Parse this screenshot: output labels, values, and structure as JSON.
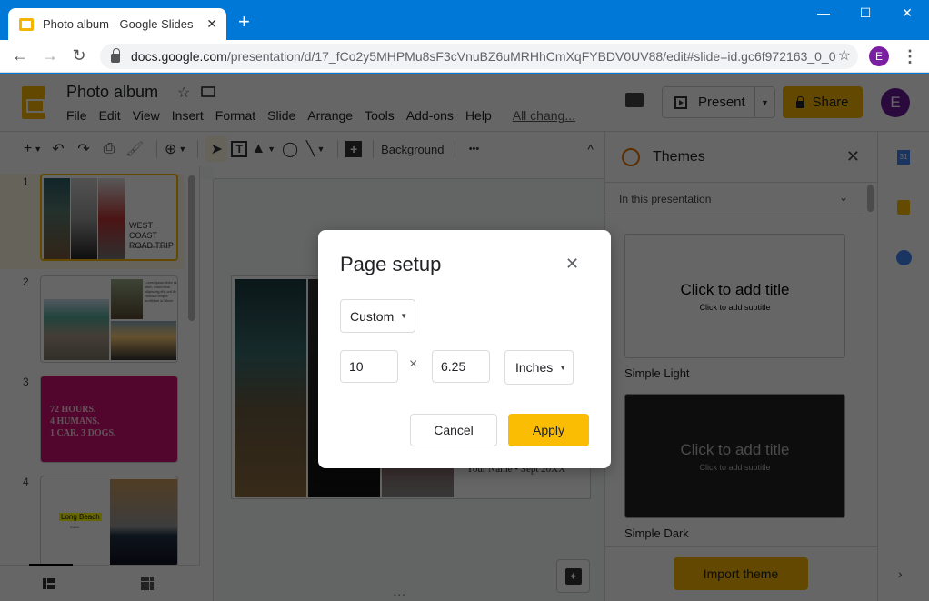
{
  "browser": {
    "tab_title": "Photo album - Google Slides",
    "tab_close": "✕",
    "new_tab": "+",
    "window_controls": {
      "minimize": "—",
      "maximize": "☐",
      "close": "✕"
    },
    "nav": {
      "back": "←",
      "forward": "→",
      "reload": "↻"
    },
    "url_host": "docs.google.com",
    "url_path": "/presentation/d/17_fCo2y5MHPMu8sF3cVnuBZ6uMRHhCmXqFYBDV0UV88/edit#slide=id.gc6f972163_0_0",
    "bookmark_star": "☆",
    "profile_initial": "E",
    "menu_kebab": "⋮"
  },
  "app": {
    "doc_title": "Photo album",
    "title_star": "☆",
    "menu": [
      "File",
      "Edit",
      "View",
      "Insert",
      "Format",
      "Slide",
      "Arrange",
      "Tools",
      "Add-ons",
      "Help"
    ],
    "save_status": "All chang...",
    "present_label": "Present",
    "present_caret": "▼",
    "share_label": "Share",
    "account_initial": "E",
    "accent_color": "#f4b400"
  },
  "toolbar": {
    "new_slide": "+",
    "caret": "▼",
    "undo": "↶",
    "redo": "↷",
    "print": "⎙",
    "paint_format": "🖌",
    "zoom": "⊕",
    "select": "➤",
    "textbox": "T",
    "image": "▲",
    "shape": "◯",
    "line": "╲",
    "comment": "+",
    "background_label": "Background",
    "more": "•••",
    "collapse": "^"
  },
  "filmstrip": {
    "slides": [
      {
        "number": "1",
        "title": "WEST COAST ROAD TRIP",
        "subtitle": "Your Name • Sept 20XX"
      },
      {
        "number": "2",
        "body": "Lorem ipsum dolor sit amet, consectetur adipiscing elit, sed do eiusmod tempor incididunt ut labore"
      },
      {
        "number": "3",
        "lines": [
          "72 HOURS.",
          "4 HUMANS.",
          "1 CAR. 3 DOGS."
        ]
      },
      {
        "number": "4",
        "title": "Long Beach",
        "subtitle": "Caption"
      }
    ]
  },
  "canvas": {
    "slide_subtext": "Your Name • Sept 20XX"
  },
  "themes": {
    "title": "Themes",
    "close": "✕",
    "filter_label": "In this presentation",
    "filter_chevron": "⌄",
    "cards": [
      {
        "name": "Simple Light",
        "title": "Click to add title",
        "subtitle": "Click to add subtitle"
      },
      {
        "name": "Simple Dark",
        "title": "Click to add title",
        "subtitle": "Click to add subtitle"
      }
    ],
    "import_label": "Import theme"
  },
  "rail": {
    "calendar_label": "31",
    "expand": "›"
  },
  "dialog": {
    "title": "Page setup",
    "close": "✕",
    "preset": "Custom",
    "caret": "▼",
    "width_value": "10",
    "height_value": "6.25",
    "times": "×",
    "unit": "Inches",
    "cancel_label": "Cancel",
    "apply_label": "Apply"
  }
}
